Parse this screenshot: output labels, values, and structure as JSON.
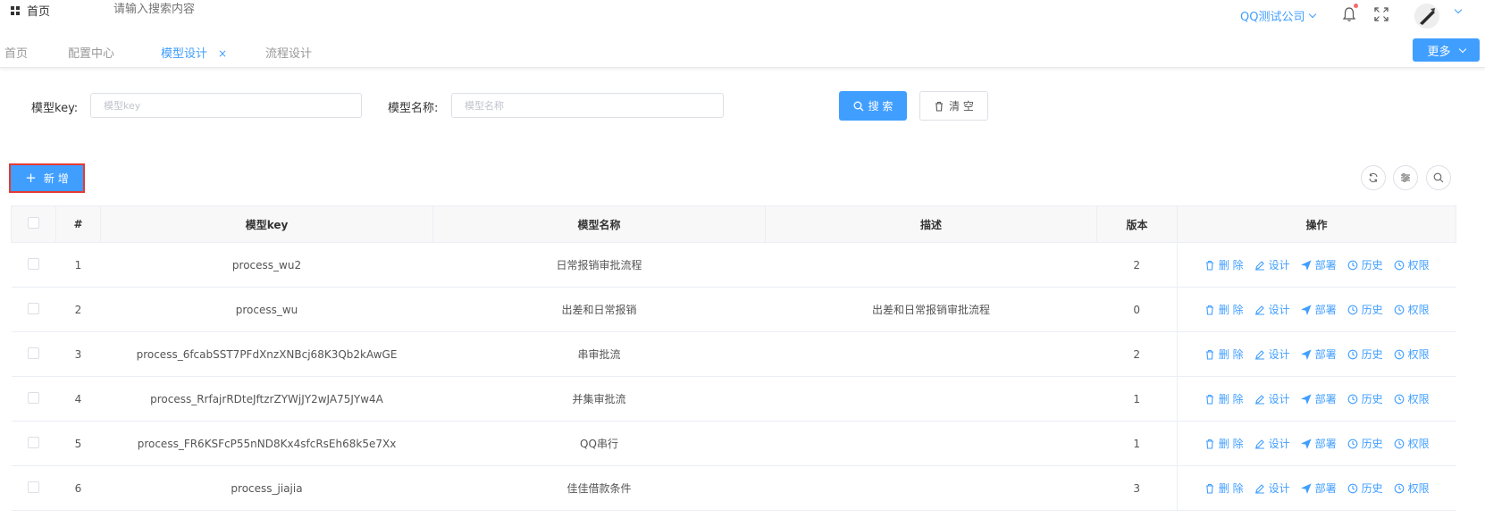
{
  "header": {
    "home_label": "首页",
    "search_placeholder": "请输入搜索内容",
    "company_label": "QQ测试公司"
  },
  "tabs": [
    {
      "label": "首页",
      "active": false
    },
    {
      "label": "配置中心",
      "active": false
    },
    {
      "label": "模型设计",
      "active": true,
      "close": "×"
    },
    {
      "label": "流程设计",
      "active": false
    }
  ],
  "more_label": "更多",
  "filter": {
    "key_label": "模型key:",
    "key_placeholder": "模型key",
    "name_label": "模型名称:",
    "name_placeholder": "模型名称",
    "search_label": "搜 索",
    "clear_label": "清 空"
  },
  "toolbar": {
    "add_label": "新 增"
  },
  "table": {
    "columns": [
      "#",
      "模型key",
      "模型名称",
      "描述",
      "版本",
      "操作"
    ],
    "rows": [
      {
        "index": "1",
        "key": "process_wu2",
        "name": "日常报销审批流程",
        "desc": "",
        "version": "2"
      },
      {
        "index": "2",
        "key": "process_wu",
        "name": "出差和日常报销",
        "desc": "出差和日常报销审批流程",
        "version": "0"
      },
      {
        "index": "3",
        "key": "process_6fcabSST7PFdXnzXNBcj68K3Qb2kAwGE",
        "name": "串审批流",
        "desc": "",
        "version": "2"
      },
      {
        "index": "4",
        "key": "process_RrfajrRDteJftzrZYWjJY2wJA75JYw4A",
        "name": "并集审批流",
        "desc": "",
        "version": "1"
      },
      {
        "index": "5",
        "key": "process_FR6KSFcP55nND8Kx4sfcRsEh68k5e7Xx",
        "name": "QQ串行",
        "desc": "",
        "version": "1"
      },
      {
        "index": "6",
        "key": "process_jiajia",
        "name": "佳佳借款条件",
        "desc": "",
        "version": "3"
      }
    ],
    "actions": [
      "删 除",
      "设计",
      "部署",
      "历史",
      "权限"
    ]
  },
  "colors": {
    "primary": "#409eff",
    "highlight": "#e53935"
  }
}
